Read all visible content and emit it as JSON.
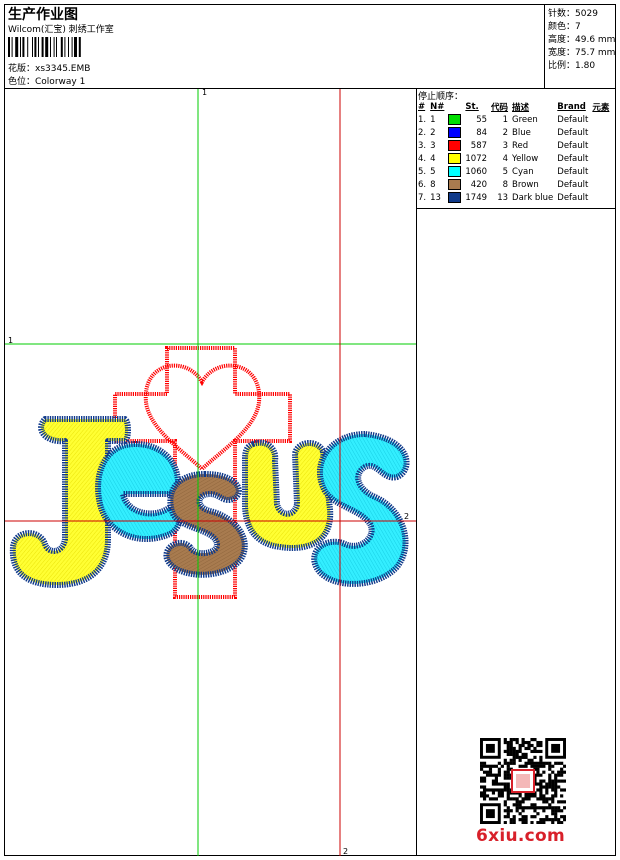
{
  "header": {
    "title": "生产作业图",
    "studio": "Wilcom(汇宝) 刺绣工作室",
    "design_label": "花版：",
    "design_value": "xs3345.EMB",
    "colorway_label": "色位：",
    "colorway_value": "Colorway 1"
  },
  "specs": [
    {
      "label": "针数：",
      "value": "5029"
    },
    {
      "label": "颜色：",
      "value": "7"
    },
    {
      "label": "高度：",
      "value": "49.6 mm"
    },
    {
      "label": "宽度：",
      "value": "75.7 mm"
    },
    {
      "label": "比例：",
      "value": "1.80"
    }
  ],
  "stop_sequence": {
    "label": "停止顺序：",
    "headers": [
      "#",
      "N#",
      "St.",
      "代码",
      "描述",
      "Brand",
      "元素"
    ],
    "rows": [
      {
        "idx": "1.",
        "n": "1",
        "color": "#00dd00",
        "st": "55",
        "code": "1",
        "desc": "Green",
        "brand": "Default"
      },
      {
        "idx": "2.",
        "n": "2",
        "color": "#0000ff",
        "st": "84",
        "code": "2",
        "desc": "Blue",
        "brand": "Default"
      },
      {
        "idx": "3.",
        "n": "3",
        "color": "#ff0000",
        "st": "587",
        "code": "3",
        "desc": "Red",
        "brand": "Default"
      },
      {
        "idx": "4.",
        "n": "4",
        "color": "#ffff00",
        "st": "1072",
        "code": "4",
        "desc": "Yellow",
        "brand": "Default"
      },
      {
        "idx": "5.",
        "n": "5",
        "color": "#00ffff",
        "st": "1060",
        "code": "5",
        "desc": "Cyan",
        "brand": "Default"
      },
      {
        "idx": "6.",
        "n": "8",
        "color": "#a87b4f",
        "st": "420",
        "code": "8",
        "desc": "Brown",
        "brand": "Default"
      },
      {
        "idx": "7.",
        "n": "13",
        "color": "#103a8a",
        "st": "1749",
        "code": "13",
        "desc": "Dark blue",
        "brand": "Default"
      }
    ]
  },
  "canvas": {
    "axis_labels": {
      "top": "1",
      "left": "1",
      "right": "2",
      "bottom": "2"
    },
    "design_text": "Jesus"
  },
  "colors": {
    "guide_green": "#00cc00",
    "guide_red": "#cc0000",
    "thread_red": "#ff0000",
    "thread_yellow": "#ffff33",
    "thread_cyan": "#33eeff",
    "thread_brown": "#a87b4f",
    "thread_darkblue": "#103a8a",
    "watermark_red": "#d8202a"
  },
  "watermark": "6xiu.com"
}
